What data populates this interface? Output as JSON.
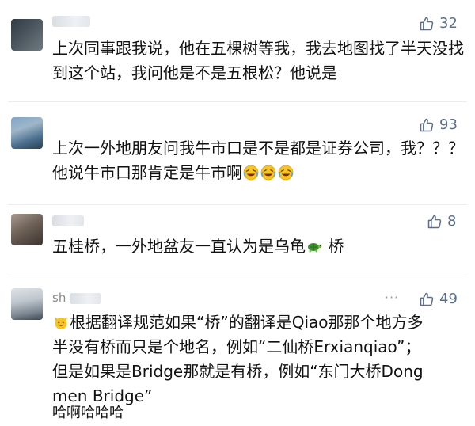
{
  "comments": [
    {
      "likes": "32",
      "text": "上次同事跟我说，他在五棵树等我，我去地图找了半天没找到这个站，我问他是不是五根松？他说是"
    },
    {
      "likes": "93",
      "text": "上次一外地朋友问我牛市口是不是都是证券公司，我？？？他说牛市口那肯定是牛市啊",
      "trailing_emoji": "laughing-crying-emoji"
    },
    {
      "likes": "8",
      "text_before_icon": "五桂桥，一外地盆友一直认为是乌龟",
      "inline_icon": "turtle-emoji",
      "text_after_icon": " 桥"
    },
    {
      "nickname": "sh",
      "more_icon": "···",
      "likes": "49",
      "leading_icon": "cat-face-emoji",
      "text": "根据翻译规范如果“桥”的翻译是Qiao那那个地方多半没有桥而只是个地名，例如“二仙桥Erxianqiao”；但是如果是Bridge那就是有桥，例如“东门大桥Dongmen Bridge”",
      "second_line": "哈啊哈哈哈"
    }
  ],
  "icons": {
    "like": "thumbs-up-outline-icon",
    "more": "more-dots-icon"
  },
  "colors": {
    "like_icon": "#5a6e8a",
    "nickname": "#8a8a8a",
    "divider": "#ececec"
  }
}
